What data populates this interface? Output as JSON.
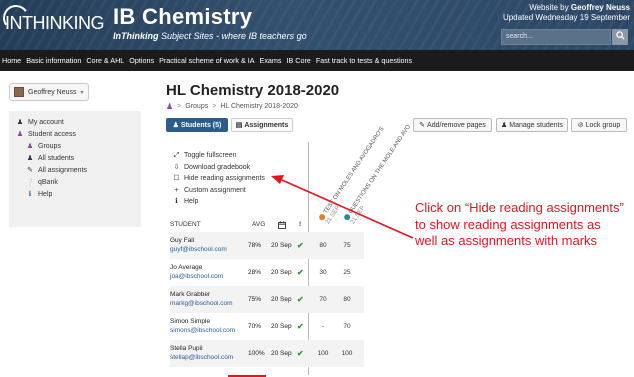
{
  "header": {
    "logo_text": "INTHINKING",
    "site_title": "IB Chemistry",
    "tagline_brand": "InThinking",
    "tagline_rest": " Subject Sites - where IB teachers go",
    "credit_prefix": "Website by ",
    "credit_author": "Geoffrey Neuss",
    "credit_updated": "Updated Wednesday 19 September",
    "search_placeholder": "search...",
    "search_icon": "search-icon"
  },
  "nav": {
    "items": [
      "Home",
      "Basic information",
      "Core & AHL",
      "Options",
      "Practical scheme of work & IA",
      "Exams",
      "IB Core",
      "Fast track to tests & questions"
    ]
  },
  "user": {
    "name": "Geoffrey Neuss",
    "caret": "▾"
  },
  "sidebar": {
    "items": [
      {
        "label": "My account",
        "icon": "user-icon"
      },
      {
        "label": "Student access",
        "icon": "group-icon"
      },
      {
        "label": "Groups",
        "icon": "group-icon"
      },
      {
        "label": "All students",
        "icon": "user-icon"
      },
      {
        "label": "All assignments",
        "icon": "pencil-icon"
      },
      {
        "label": "qBank",
        "icon": "question-icon"
      },
      {
        "label": "Help",
        "icon": "info-icon"
      }
    ]
  },
  "page": {
    "title": "HL Chemistry 2018-2020",
    "breadcrumb": [
      "Groups",
      "HL Chemistry 2018-2020"
    ],
    "tabs": {
      "students": "Students (5)",
      "assignments": "Assignments"
    },
    "actions": {
      "add_remove": "Add/remove pages",
      "manage": "Manage students",
      "lock": "Lock group"
    }
  },
  "tools": [
    {
      "label": "Toggle fullscreen",
      "icon": "expand-icon"
    },
    {
      "label": "Download gradebook",
      "icon": "download-icon"
    },
    {
      "label": "Hide reading assignments",
      "icon": "checkbox-icon"
    },
    {
      "label": "Custom assignment",
      "icon": "plus-icon"
    },
    {
      "label": "Help",
      "icon": "info-icon"
    }
  ],
  "columns": {
    "assignment1": "TEST ON MOLES AND AVOGADRO'S",
    "assignment1_date": "21 SEP",
    "assignment2": "QUESTIONS ON THE MOLE AND AVO",
    "assignment2_date": "21 SEP"
  },
  "table": {
    "headers": {
      "student": "STUDENT",
      "avg": "AVG",
      "calendar_icon": "calendar-icon",
      "alert": "!"
    },
    "rows": [
      {
        "name": "Guy Fall",
        "email": "guyf@ibschool.com",
        "avg": "78%",
        "date": "20 Sep",
        "check": "✔",
        "m1": "80",
        "m2": "75"
      },
      {
        "name": "Jo Average",
        "email": "joa@ibschool.com",
        "avg": "28%",
        "date": "20 Sep",
        "check": "✔",
        "m1": "30",
        "m2": "25"
      },
      {
        "name": "Mark Grabber",
        "email": "markg@ibschool.com",
        "avg": "75%",
        "date": "20 Sep",
        "check": "✔",
        "m1": "70",
        "m2": "80"
      },
      {
        "name": "Simon Simple",
        "email": "simons@ibschool.com",
        "avg": "70%",
        "date": "20 Sep",
        "check": "✔",
        "m1": "-",
        "m2": "70"
      },
      {
        "name": "Stella Pupil",
        "email": "stellap@ibschool.com",
        "avg": "100%",
        "date": "20 Sep",
        "check": "✔",
        "m1": "100",
        "m2": "100"
      }
    ]
  },
  "annotation": {
    "text": "Click on “Hide reading assignments” to show reading assignments as well as assignments with marks",
    "color": "#e8141c"
  }
}
